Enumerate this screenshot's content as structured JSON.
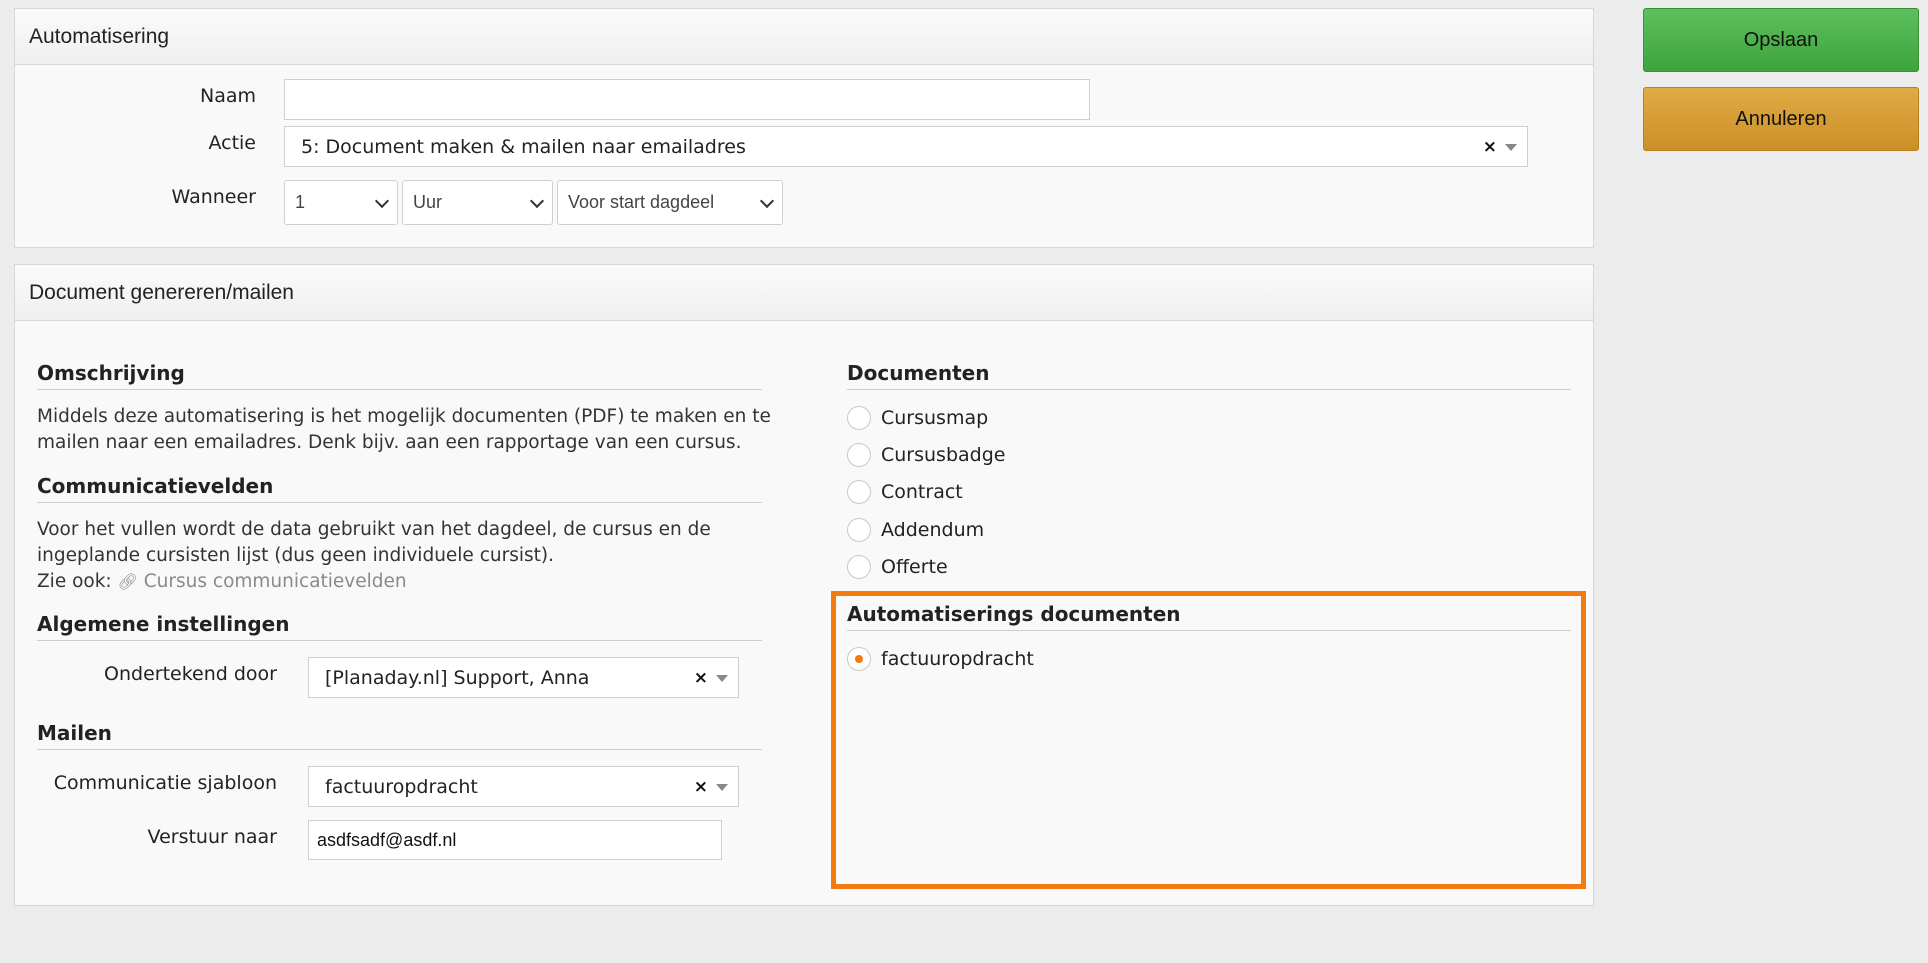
{
  "buttons": {
    "save": "Opslaan",
    "cancel": "Annuleren"
  },
  "automation": {
    "title": "Automatisering",
    "name": {
      "label": "Naam",
      "value": ""
    },
    "action": {
      "label": "Actie",
      "value": "5: Document maken & mailen naar emailadres",
      "clear": "×"
    },
    "when": {
      "label": "Wanneer",
      "amount": "1",
      "unit": "Uur",
      "moment": "Voor start dagdeel"
    }
  },
  "document_panel": {
    "title": "Document genereren/mailen",
    "description": {
      "title": "Omschrijving",
      "text": "Middels deze automatisering is het mogelijk documenten (PDF) te maken en te mailen naar een emailadres. Denk bijv. aan een rapportage van een cursus."
    },
    "communication_fields": {
      "title": "Communicatievelden",
      "text": "Voor het vullen wordt de data gebruikt van het dagdeel, de cursus en de ingeplande cursisten lijst (dus geen individuele cursist).",
      "see_also": "Zie ook:",
      "link_icon": "link-icon",
      "link_text": "Cursus communicatievelden"
    },
    "general_settings": {
      "title": "Algemene instellingen",
      "signed_by_label": "Ondertekend door",
      "signed_by_value": "[Planaday.nl] Support, Anna",
      "clear": "×"
    },
    "mail": {
      "title": "Mailen",
      "template_label": "Communicatie sjabloon",
      "template_value": "factuuropdracht",
      "send_to_label": "Verstuur naar",
      "send_to_value": "asdfsadf@asdf.nl",
      "clear": "×"
    },
    "documents": {
      "title": "Documenten",
      "items": [
        "Cursusmap",
        "Cursusbadge",
        "Contract",
        "Addendum",
        "Offerte"
      ]
    },
    "automation_documents": {
      "title": "Automatiserings documenten",
      "items": [
        "factuuropdracht"
      ],
      "selected": "factuuropdracht"
    }
  },
  "colors": {
    "highlight": "#f47b10",
    "save": "#4cb34c",
    "cancel": "#d69a33"
  }
}
